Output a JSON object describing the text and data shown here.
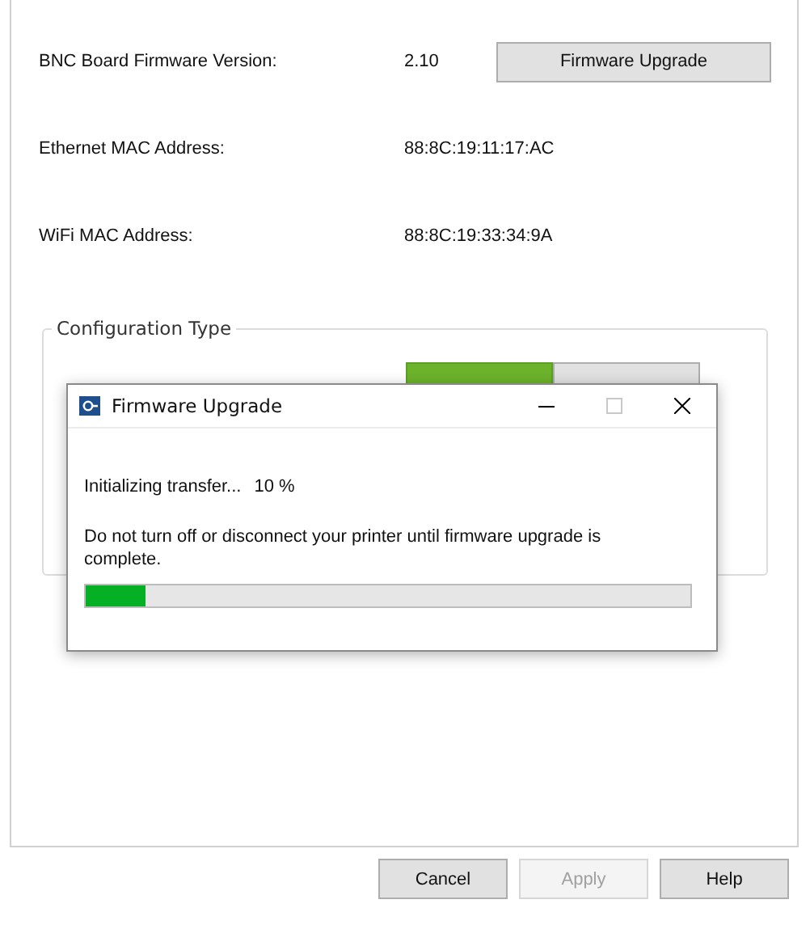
{
  "info_rows": [
    {
      "label": "BNC Board Firmware Version:",
      "value": "2.10",
      "button": "Firmware Upgrade"
    },
    {
      "label": "Ethernet MAC Address:",
      "value": "88:8C:19:11:17:AC"
    },
    {
      "label": "WiFi MAC Address:",
      "value": "88:8C:19:33:34:9A"
    }
  ],
  "configuration": {
    "title": "Configuration Type",
    "segments": [
      {
        "selected": true
      },
      {
        "selected": false
      }
    ]
  },
  "dialog": {
    "title": "Firmware Upgrade",
    "status": "Initializing transfer...",
    "percent": "10 %",
    "message": "Do not turn off or disconnect your printer until firmware upgrade is complete.",
    "level": 0.1
  },
  "buttons": [
    {
      "label": "Cancel",
      "disabled": false
    },
    {
      "label": "Apply",
      "disabled": true
    },
    {
      "label": "Help",
      "disabled": false
    }
  ]
}
